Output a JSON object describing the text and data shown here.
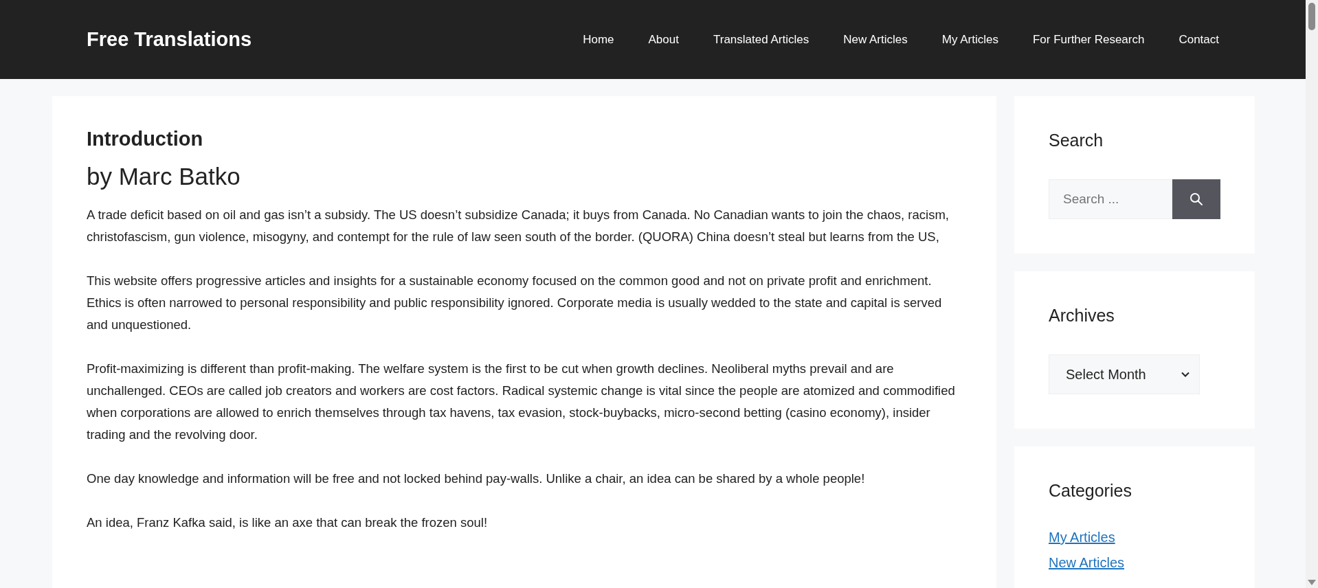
{
  "site_title": "Free Translations",
  "nav": [
    {
      "label": "Home"
    },
    {
      "label": "About"
    },
    {
      "label": "Translated Articles"
    },
    {
      "label": "New Articles"
    },
    {
      "label": "My Articles"
    },
    {
      "label": "For Further Research"
    },
    {
      "label": "Contact"
    }
  ],
  "article": {
    "title": "Introduction",
    "byline": "by Marc Batko",
    "paragraphs": [
      "A trade deficit based on oil and gas isn’t a subsidy. The US doesn’t subsidize Canada; it buys from Canada. No Canadian wants to join the chaos, racism, christofascism, gun violence, misogyny, and contempt for the rule of law seen south of the border.  (QUORA) China doesn’t steal but learns from the US,",
      "This website offers progressive articles and insights for a sustainable economy focused on the common good and not on private profit and enrichment.  Ethics is often narrowed to personal responsibility and public responsibility ignored.  Corporate media is usually wedded to the state and capital is served and unquestioned.",
      "Profit-maximizing is different than profit-making.  The welfare system is the first to be cut when growth declines.  Neoliberal myths prevail and are unchallenged.  CEOs are called job creators and workers are cost factors. Radical systemic change is vital since the people are atomized and commodified when corporations are allowed to enrich themselves through tax havens, tax evasion, stock-buybacks, micro-second betting (casino economy), insider trading and the revolving door.",
      "One day knowledge and information will be free and not locked behind pay-walls.  Unlike a chair, an idea can be shared by a whole people!",
      "An idea, Franz Kafka said, is like an axe that can break the frozen soul!"
    ]
  },
  "sidebar": [
    {
      "kind": "search",
      "title": "Search",
      "placeholder": "Search ..."
    },
    {
      "kind": "select",
      "title": "Archives",
      "value": "Select Month"
    },
    {
      "kind": "links",
      "title": "Categories",
      "links": [
        "My Articles",
        "New Articles"
      ]
    }
  ]
}
